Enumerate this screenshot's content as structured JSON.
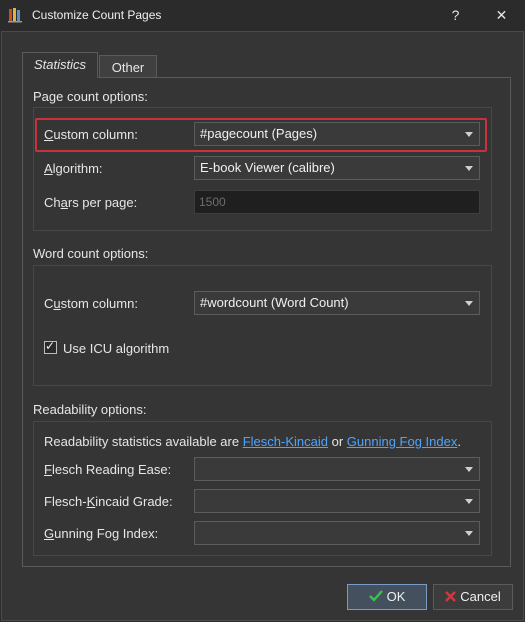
{
  "window": {
    "title": "Customize Count Pages",
    "help_glyph": "?",
    "close_glyph": "✕"
  },
  "tabs": [
    {
      "label": "Statistics",
      "active": true
    },
    {
      "label": "Other",
      "active": false
    }
  ],
  "page_count": {
    "section_label": "Page count options:",
    "custom_column_label": {
      "mnemonic": "C",
      "rest": "ustom column:"
    },
    "custom_column_value": "#pagecount (Pages)",
    "algorithm_label": {
      "mnemonic": "A",
      "rest": "lgorithm:"
    },
    "algorithm_value": "E-book Viewer (calibre)",
    "chars_label": {
      "pre": "Ch",
      "mnemonic": "a",
      "rest": "rs per page:"
    },
    "chars_value": "1500"
  },
  "word_count": {
    "section_label": "Word count options:",
    "custom_column_label": {
      "pre": "C",
      "mnemonic": "u",
      "rest": "stom column:"
    },
    "custom_column_value": "#wordcount (Word Count)",
    "icu_label": "Use ICU algorithm",
    "icu_checked": true
  },
  "readability": {
    "section_label": "Readability options:",
    "info_prefix": "Readability statistics available are ",
    "link1": "Flesch-Kincaid",
    "info_mid": " or ",
    "link2": "Gunning Fog Index",
    "info_suffix": ".",
    "flesch_ease_label": {
      "mnemonic": "F",
      "rest": "lesch Reading Ease:"
    },
    "flesch_ease_value": "",
    "flesch_grade_label": {
      "pre": "Flesch-",
      "mnemonic": "K",
      "rest": "incaid Grade:"
    },
    "flesch_grade_value": "",
    "gunning_label": {
      "mnemonic": "G",
      "rest": "unning Fog Index:"
    },
    "gunning_value": ""
  },
  "buttons": {
    "ok": "OK",
    "cancel": "Cancel"
  },
  "colors": {
    "ok_icon": "#3cc24a",
    "cancel_icon": "#e0313b",
    "link": "#4ea3ff",
    "highlight": "#c8323c"
  }
}
